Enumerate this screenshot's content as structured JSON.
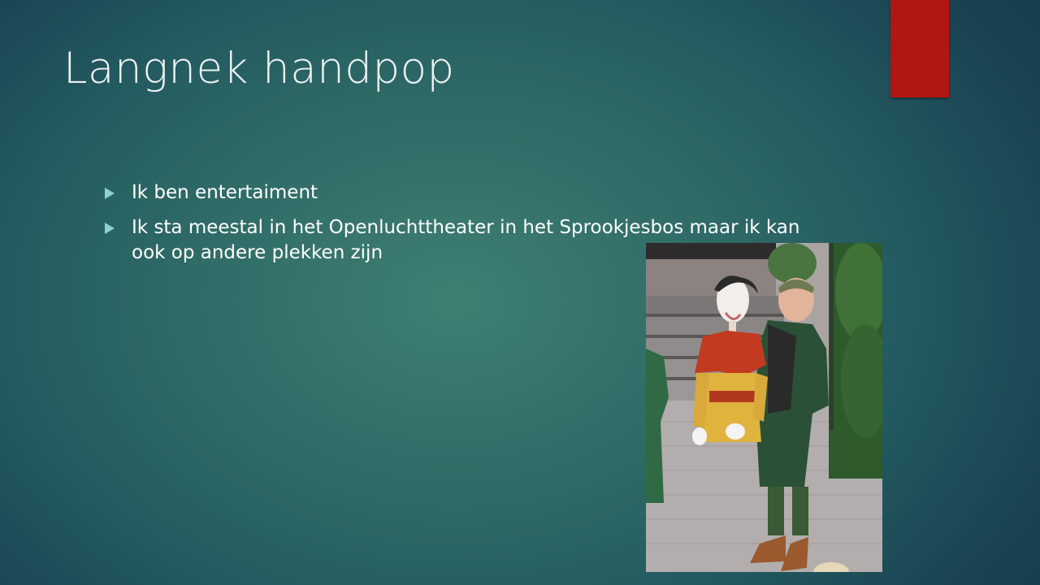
{
  "slide": {
    "title": "Langnek handpop",
    "bullets": [
      "Ik ben entertaiment",
      "Ik sta meestal in het Openluchttheater in het Sprookjesbos maar ik kan ook op andere plekken zijn"
    ],
    "accent_color": "#b01613",
    "bullet_color": "#8fd0d4",
    "icons": {
      "bullet": "triangle-right-icon"
    }
  }
}
